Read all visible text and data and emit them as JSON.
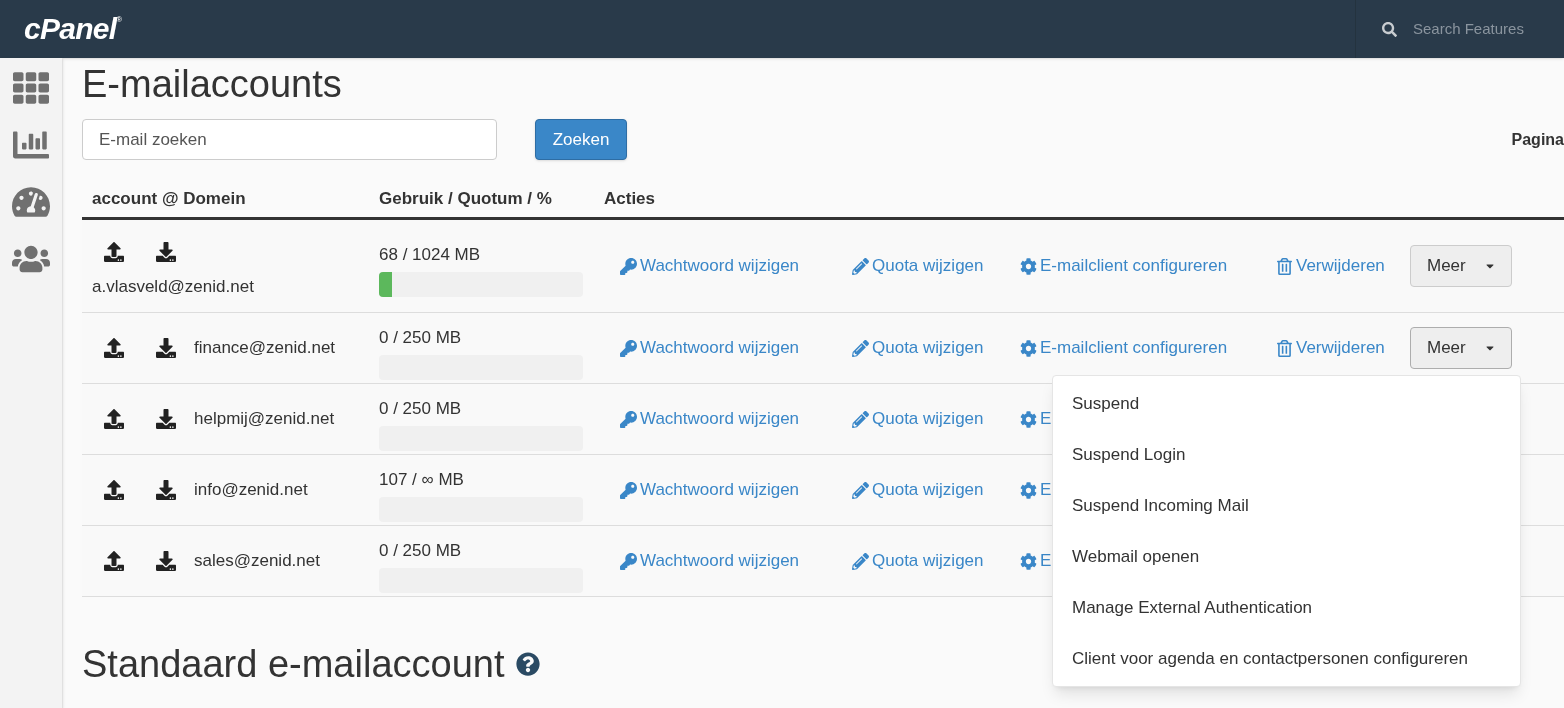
{
  "header": {
    "logo": "cPanel",
    "logo_mark": "®",
    "search": {
      "placeholder": "Search Features"
    }
  },
  "sidebar": {
    "items": [
      {
        "kind": "grid"
      },
      {
        "kind": "stats"
      },
      {
        "kind": "gauge"
      },
      {
        "kind": "users"
      }
    ]
  },
  "title": "E-mailaccounts",
  "search": {
    "placeholder": "E-mail zoeken",
    "button": "Zoeken"
  },
  "pagination_label": "Pagina",
  "table": {
    "columns": [
      "account @ Domein",
      "Gebruik / Quotum / %",
      "Acties"
    ],
    "rows": [
      {
        "kind": "stacked",
        "email": "a.vlasveld@zenid.net",
        "usage": "68 / 1024 MB",
        "level": 0.066,
        "password": "Wachtwoord wijzigen",
        "quota": "Quota wijzigen",
        "configure": "E-mailclient configureren",
        "delete": "Verwijderen",
        "more": "Meer"
      },
      {
        "kind": "inline",
        "email": "finance@zenid.net",
        "usage": "0 / 250 MB",
        "password": "Wachtwoord wijzigen",
        "quota": "Quota wijzigen",
        "configure": "E-mailclient configureren",
        "delete": "Verwijderen",
        "more": "Meer"
      },
      {
        "kind": "inline",
        "email": "helpmij@zenid.net",
        "usage": "0 / 250 MB",
        "password": "Wachtwoord wijzigen",
        "quota": "Quota wijzigen",
        "configure": "E"
      },
      {
        "kind": "inline",
        "email": "info@zenid.net",
        "usage": "107 / ∞ MB",
        "password": "Wachtwoord wijzigen",
        "quota": "Quota wijzigen",
        "configure": "E"
      },
      {
        "kind": "inline",
        "email": "sales@zenid.net",
        "usage": "0 / 250 MB",
        "password": "Wachtwoord wijzigen",
        "quota": "Quota wijzigen",
        "configure": "E"
      }
    ]
  },
  "more_menu": {
    "items": [
      "Suspend",
      "Suspend Login",
      "Suspend Incoming Mail",
      "Webmail openen",
      "Manage External Authentication",
      "Client voor agenda en contactpersonen configureren"
    ]
  },
  "default_section": {
    "title": "Standaard e-mailaccount"
  }
}
